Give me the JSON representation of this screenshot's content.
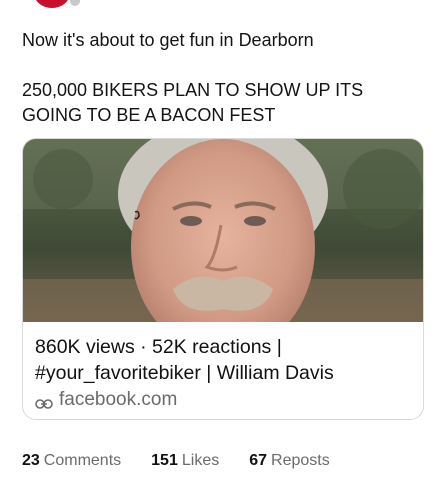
{
  "post": {
    "line1": "Now it's about to get fun in Dearborn",
    "line2": "250,000 BIKERS PLAN TO SHOW UP ITS GOING TO BE A BACON FEST"
  },
  "link_card": {
    "title": "860K views · 52K reactions | #your_favoritebiker | William Davis",
    "source": "facebook.com"
  },
  "engagement": {
    "comments_count": "23",
    "comments_label": "Comments",
    "likes_count": "151",
    "likes_label": "Likes",
    "reposts_count": "67",
    "reposts_label": "Reposts"
  },
  "colors": {
    "accent": "#c8102e",
    "muted_text": "#6b6b6b"
  },
  "icons": [
    "link-icon"
  ]
}
